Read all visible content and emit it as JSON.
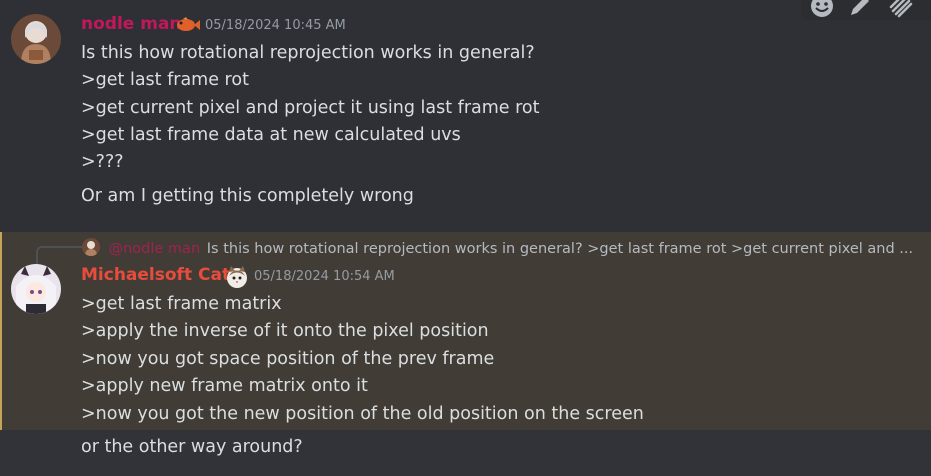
{
  "toolbar": {
    "reaction_icon": "emoji-smile-icon",
    "edit_icon": "pencil-icon",
    "more_icon": "threads-icon"
  },
  "messages": [
    {
      "author": "nodle man",
      "author_color": "#c2185b",
      "badge_icon": "fish-icon",
      "timestamp": "05/18/2024 10:45 AM",
      "lines": [
        "Is this how rotational reprojection works in general?",
        ">get last frame rot",
        ">get current pixel and project it using last frame rot",
        ">get last frame data at new calculated uvs",
        ">???"
      ],
      "followup": "Or am I getting this completely wrong"
    },
    {
      "reply_to": {
        "mention": "@nodle man",
        "preview": "Is this how rotational reprojection works in general? >get last frame rot >get current pixel and ..."
      },
      "author": "Michaelsoft Cat",
      "author_color": "#e74c3c",
      "timestamp": "05/18/2024 10:54 AM",
      "lines": [
        ">get last frame matrix",
        ">apply the inverse of it onto the pixel position",
        ">now you got space position of the prev frame",
        ">apply new frame matrix onto it",
        ">now you got the new position of the old position on the screen"
      ],
      "followup": "or the other way around?"
    }
  ]
}
